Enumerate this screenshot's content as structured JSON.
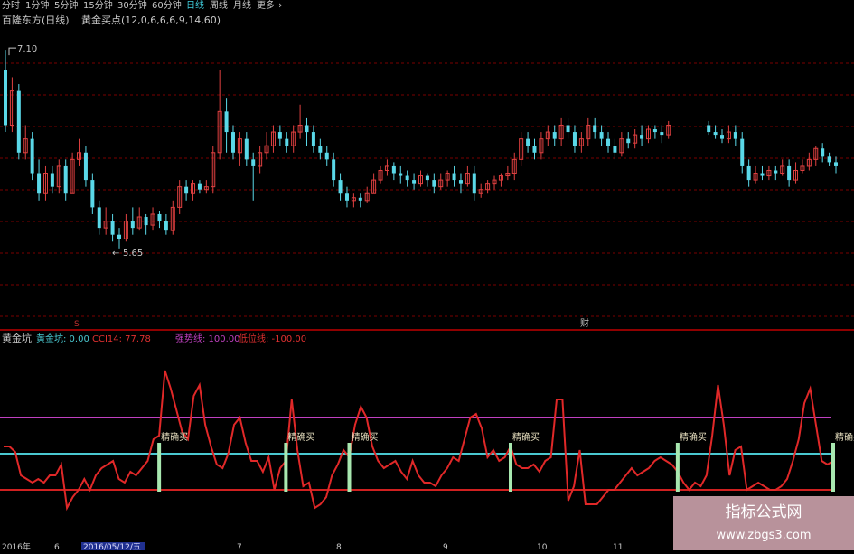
{
  "toolbar": {
    "items": [
      "分时",
      "1分钟",
      "5分钟",
      "15分钟",
      "30分钟",
      "60分钟",
      "日线",
      "周线",
      "月线",
      "更多"
    ],
    "active_index": 6,
    "more_glyph": "›"
  },
  "main_panel": {
    "title": "百隆东方(日线)",
    "formula": "黄金买点(12,0,6,6,6,9,14,60)",
    "high_marker": "7.10",
    "low_marker": "5.65",
    "event_markers": [
      "S",
      "财"
    ]
  },
  "sub_panel": {
    "title": "黄金坑",
    "legend": [
      {
        "label": "黄金坑: 0.00",
        "color": "#4ac8d0"
      },
      {
        "label": "CCI14: 77.78",
        "color": "#e03030"
      },
      {
        "label": "强势线: 100.00",
        "color": "#c040c0"
      },
      {
        "label": "低位线: -100.00",
        "color": "#e03030"
      }
    ],
    "signal_label": "精确买"
  },
  "date_axis": {
    "labels": [
      "2016年",
      "6",
      "2016/05/12/五",
      "7",
      "8",
      "9",
      "10",
      "11"
    ],
    "highlight_index": 2
  },
  "watermark": {
    "line1": "指标公式网",
    "line2": "www.zbgs3.com"
  },
  "colors": {
    "up": "#e04040",
    "down": "#5ad8e8",
    "grid": "#7a0000",
    "separator": "#c00000",
    "cci": "#e02828",
    "strong_line": "#c040c0",
    "zero_line": "#4ac8d0",
    "low_line": "#d02020",
    "signal_bar": "#a8e8b0",
    "signal_text": "#e8e0c0",
    "text": "#c8c8c8",
    "active_tab": "#40d0e0"
  },
  "chart_data": [
    {
      "type": "candlestick",
      "title": "百隆东方(日线)",
      "price_range": [
        5.65,
        7.1
      ],
      "candles": [
        [
          6.95,
          6.55,
          7.1,
          6.5
        ],
        [
          6.55,
          6.8,
          6.9,
          6.5
        ],
        [
          6.8,
          6.35,
          6.85,
          6.3
        ],
        [
          6.35,
          6.45,
          6.55,
          6.3
        ],
        [
          6.45,
          6.2,
          6.5,
          6.15
        ],
        [
          6.2,
          6.05,
          6.3,
          6.0
        ],
        [
          6.05,
          6.2,
          6.25,
          6.0
        ],
        [
          6.2,
          6.1,
          6.25,
          6.05
        ],
        [
          6.1,
          6.25,
          6.3,
          6.05
        ],
        [
          6.25,
          6.05,
          6.3,
          6.0
        ],
        [
          6.05,
          6.3,
          6.35,
          6.05
        ],
        [
          6.3,
          6.35,
          6.45,
          6.25
        ],
        [
          6.35,
          6.15,
          6.4,
          6.1
        ],
        [
          6.15,
          5.95,
          6.2,
          5.9
        ],
        [
          5.95,
          5.8,
          6.0,
          5.75
        ],
        [
          5.8,
          5.85,
          5.95,
          5.75
        ],
        [
          5.85,
          5.75,
          5.9,
          5.7
        ],
        [
          5.75,
          5.72,
          5.8,
          5.65
        ],
        [
          5.72,
          5.85,
          5.9,
          5.7
        ],
        [
          5.85,
          5.8,
          5.95,
          5.75
        ],
        [
          5.8,
          5.88,
          5.95,
          5.78
        ],
        [
          5.88,
          5.82,
          5.9,
          5.75
        ],
        [
          5.82,
          5.9,
          5.95,
          5.78
        ],
        [
          5.9,
          5.85,
          5.92,
          5.8
        ],
        [
          5.85,
          5.78,
          5.9,
          5.75
        ],
        [
          5.78,
          5.95,
          6.0,
          5.75
        ],
        [
          5.95,
          6.1,
          6.15,
          5.9
        ],
        [
          6.1,
          6.05,
          6.15,
          6.0
        ],
        [
          6.05,
          6.12,
          6.15,
          6.0
        ],
        [
          6.12,
          6.08,
          6.15,
          6.05
        ],
        [
          6.08,
          6.1,
          6.15,
          6.05
        ],
        [
          6.1,
          6.35,
          6.4,
          6.05
        ],
        [
          6.35,
          6.65,
          6.95,
          6.3
        ],
        [
          6.65,
          6.5,
          6.75,
          6.35
        ],
        [
          6.5,
          6.35,
          6.55,
          6.3
        ],
        [
          6.35,
          6.45,
          6.5,
          6.25
        ],
        [
          6.45,
          6.3,
          6.5,
          6.25
        ],
        [
          6.3,
          6.25,
          6.35,
          6.0
        ],
        [
          6.25,
          6.35,
          6.4,
          6.2
        ],
        [
          6.35,
          6.4,
          6.5,
          6.3
        ],
        [
          6.4,
          6.5,
          6.55,
          6.35
        ],
        [
          6.5,
          6.45,
          6.55,
          6.4
        ],
        [
          6.45,
          6.4,
          6.5,
          6.35
        ],
        [
          6.4,
          6.5,
          6.55,
          6.35
        ],
        [
          6.5,
          6.55,
          6.7,
          6.45
        ],
        [
          6.55,
          6.5,
          6.6,
          6.4
        ],
        [
          6.5,
          6.4,
          6.55,
          6.35
        ],
        [
          6.4,
          6.35,
          6.45,
          6.3
        ],
        [
          6.35,
          6.3,
          6.4,
          6.25
        ],
        [
          6.3,
          6.15,
          6.35,
          6.1
        ],
        [
          6.15,
          6.05,
          6.2,
          6.0
        ],
        [
          6.05,
          6.0,
          6.1,
          5.95
        ],
        [
          6.0,
          6.02,
          6.05,
          5.95
        ],
        [
          6.02,
          6.0,
          6.05,
          5.95
        ],
        [
          6.0,
          6.05,
          6.1,
          5.98
        ],
        [
          6.05,
          6.15,
          6.2,
          6.05
        ],
        [
          6.15,
          6.22,
          6.25,
          6.12
        ],
        [
          6.22,
          6.25,
          6.3,
          6.18
        ],
        [
          6.25,
          6.2,
          6.28,
          6.15
        ],
        [
          6.2,
          6.18,
          6.25,
          6.12
        ],
        [
          6.18,
          6.15,
          6.22,
          6.1
        ],
        [
          6.15,
          6.12,
          6.2,
          6.08
        ],
        [
          6.12,
          6.18,
          6.22,
          6.1
        ],
        [
          6.18,
          6.15,
          6.2,
          6.1
        ],
        [
          6.15,
          6.1,
          6.2,
          6.05
        ],
        [
          6.1,
          6.15,
          6.2,
          6.08
        ],
        [
          6.15,
          6.2,
          6.22,
          6.1
        ],
        [
          6.2,
          6.15,
          6.25,
          6.1
        ],
        [
          6.15,
          6.12,
          6.2,
          6.05
        ],
        [
          6.12,
          6.2,
          6.25,
          6.1
        ],
        [
          6.2,
          6.05,
          6.25,
          6.0
        ],
        [
          6.05,
          6.08,
          6.12,
          6.02
        ],
        [
          6.08,
          6.12,
          6.15,
          6.05
        ],
        [
          6.12,
          6.15,
          6.18,
          6.08
        ],
        [
          6.15,
          6.18,
          6.2,
          6.1
        ],
        [
          6.18,
          6.2,
          6.25,
          6.15
        ],
        [
          6.2,
          6.3,
          6.35,
          6.15
        ],
        [
          6.3,
          6.45,
          6.5,
          6.25
        ],
        [
          6.45,
          6.4,
          6.5,
          6.35
        ],
        [
          6.4,
          6.35,
          6.45,
          6.3
        ],
        [
          6.35,
          6.45,
          6.5,
          6.3
        ],
        [
          6.45,
          6.5,
          6.55,
          6.4
        ],
        [
          6.5,
          6.45,
          6.55,
          6.4
        ],
        [
          6.45,
          6.55,
          6.6,
          6.4
        ],
        [
          6.55,
          6.5,
          6.6,
          6.45
        ],
        [
          6.5,
          6.4,
          6.55,
          6.35
        ],
        [
          6.4,
          6.45,
          6.5,
          6.35
        ],
        [
          6.45,
          6.55,
          6.6,
          6.4
        ],
        [
          6.55,
          6.5,
          6.6,
          6.45
        ],
        [
          6.5,
          6.45,
          6.55,
          6.4
        ],
        [
          6.45,
          6.4,
          6.5,
          6.35
        ],
        [
          6.4,
          6.35,
          6.45,
          6.3
        ],
        [
          6.35,
          6.45,
          6.5,
          6.32
        ],
        [
          6.45,
          6.42,
          6.5,
          6.38
        ],
        [
          6.42,
          6.48,
          6.52,
          6.38
        ],
        [
          6.48,
          6.45,
          6.55,
          6.4
        ],
        [
          6.45,
          6.52,
          6.55,
          6.42
        ],
        [
          6.52,
          6.5,
          6.55,
          6.45
        ],
        [
          6.5,
          6.48,
          6.55,
          6.42
        ],
        [
          6.48,
          6.55,
          6.58,
          6.45
        ],
        [
          null,
          null,
          null,
          null
        ],
        [
          null,
          null,
          null,
          null
        ],
        [
          null,
          null,
          null,
          null
        ],
        [
          null,
          null,
          null,
          null
        ],
        [
          null,
          null,
          null,
          null
        ],
        [
          6.55,
          6.5,
          6.58,
          6.48
        ],
        [
          6.5,
          6.48,
          6.55,
          6.45
        ],
        [
          6.48,
          6.45,
          6.52,
          6.42
        ],
        [
          6.45,
          6.5,
          6.55,
          6.42
        ],
        [
          6.5,
          6.45,
          6.55,
          6.4
        ],
        [
          6.45,
          6.25,
          6.5,
          6.2
        ],
        [
          6.25,
          6.15,
          6.3,
          6.1
        ],
        [
          6.15,
          6.2,
          6.25,
          6.12
        ],
        [
          6.2,
          6.18,
          6.25,
          6.15
        ],
        [
          6.18,
          6.22,
          6.25,
          6.15
        ],
        [
          6.22,
          6.2,
          6.25,
          6.15
        ],
        [
          6.2,
          6.25,
          6.3,
          6.18
        ],
        [
          6.25,
          6.15,
          6.3,
          6.1
        ],
        [
          6.15,
          6.22,
          6.28,
          6.12
        ],
        [
          6.22,
          6.25,
          6.3,
          6.2
        ],
        [
          6.25,
          6.3,
          6.35,
          6.22
        ],
        [
          6.3,
          6.38,
          6.4,
          6.25
        ],
        [
          6.38,
          6.32,
          6.42,
          6.28
        ],
        [
          6.32,
          6.28,
          6.35,
          6.25
        ],
        [
          6.28,
          6.25,
          6.32,
          6.2
        ]
      ]
    },
    {
      "type": "line",
      "title": "黄金坑",
      "ylim": [
        -100,
        100
      ],
      "series": [
        {
          "name": "CCI14",
          "values": [
            20,
            20,
            5,
            -60,
            -70,
            -80,
            -70,
            -80,
            -60,
            -60,
            -30,
            -150,
            -120,
            -100,
            -70,
            -100,
            -60,
            -40,
            -30,
            -20,
            -70,
            -80,
            -50,
            -60,
            -40,
            -20,
            40,
            50,
            230,
            180,
            120,
            60,
            40,
            160,
            190,
            80,
            20,
            -30,
            -40,
            0,
            80,
            100,
            30,
            -20,
            -20,
            -50,
            -10,
            -100,
            -40,
            -20,
            150,
            10,
            -90,
            -80,
            -150,
            -140,
            -120,
            -60,
            -30,
            10,
            -10,
            80,
            130,
            100,
            20,
            -20,
            -40,
            -30,
            -20,
            -50,
            -70,
            -20,
            -60,
            -80,
            -80,
            -90,
            -60,
            -40,
            -10,
            -20,
            40,
            100,
            110,
            70,
            -10,
            10,
            -20,
            -10,
            20,
            -30,
            -40,
            -40,
            -30,
            -50,
            -20,
            -10,
            150,
            150,
            -130,
            -90,
            10,
            -140,
            -140,
            -140,
            -120,
            -100,
            -100,
            -80,
            -60,
            -40,
            -60,
            -50,
            -40,
            -20,
            -10,
            -20,
            -30,
            -50,
            -80,
            -100,
            -80,
            -90,
            -60,
            50,
            190,
            80,
            -60,
            10,
            20,
            -100,
            -90,
            -80,
            -90,
            -100,
            -100,
            -90,
            -70,
            -20,
            40,
            140,
            180,
            80,
            -20,
            -30,
            -20
          ]
        }
      ],
      "reference_lines": [
        {
          "name": "强势线",
          "value": 100
        },
        {
          "name": "黄金坑",
          "value": 0
        },
        {
          "name": "低位线",
          "value": -100
        }
      ],
      "signal_positions": [
        27,
        49,
        60,
        88,
        117,
        144
      ]
    }
  ]
}
